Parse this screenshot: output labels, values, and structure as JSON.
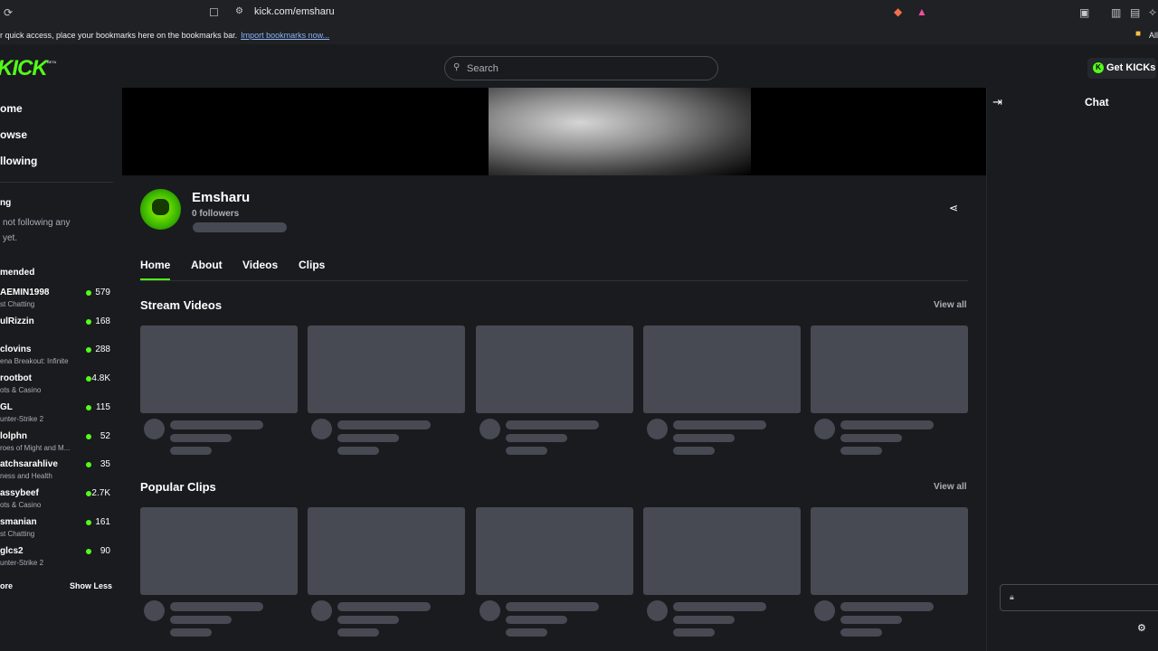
{
  "browser": {
    "url": "kick.com/emsharu",
    "bookmarks_text": "r quick access, place your bookmarks here on the bookmarks bar.",
    "bookmarks_link": "Import bookmarks now...",
    "bookmarks_right": "All",
    "reload_icon": "reload-icon",
    "bookmark_icon": "bookmark-icon"
  },
  "nav": {
    "logo": "KICK",
    "logo_badge": "BETA",
    "search_placeholder": "Search",
    "get_kicks": "Get KICKs"
  },
  "sidebar": {
    "nav": [
      "ome",
      "owse",
      "llowing"
    ],
    "following_heading": "ng",
    "following_empty_1": "not following any",
    "following_empty_2": "yet.",
    "recommended_heading": "mended",
    "recommended": [
      {
        "name": "AEMIN1998",
        "category": "st Chatting",
        "viewers": "579"
      },
      {
        "name": "ulRizzin",
        "category": "",
        "viewers": "168"
      },
      {
        "name": "clovins",
        "category": "ena Breakout: Infinite",
        "viewers": "288"
      },
      {
        "name": "rootbot",
        "category": "ots & Casino",
        "viewers": "4.8K"
      },
      {
        "name": "GL",
        "category": "unter-Strike 2",
        "viewers": "115"
      },
      {
        "name": "lolphn",
        "category": "roes of Might and M...",
        "viewers": "52"
      },
      {
        "name": "atchsarahlive",
        "category": "ness and Health",
        "viewers": "35"
      },
      {
        "name": "assybeef",
        "category": "ots & Casino",
        "viewers": "2.7K"
      },
      {
        "name": "smanian",
        "category": "st Chatting",
        "viewers": "161"
      },
      {
        "name": "glcs2",
        "category": "unter-Strike 2",
        "viewers": "90"
      }
    ],
    "show_more": "ore",
    "show_less": "Show Less"
  },
  "channel": {
    "name": "Emsharu",
    "followers": "0 followers",
    "tabs": [
      "Home",
      "About",
      "Videos",
      "Clips"
    ],
    "active_tab": "Home"
  },
  "sections": [
    {
      "title": "Stream Videos",
      "view_all": "View all"
    },
    {
      "title": "Popular Clips",
      "view_all": "View all"
    }
  ],
  "chat": {
    "title": "Chat"
  },
  "colors": {
    "accent": "#53fc18",
    "background": "#191b1f",
    "skeleton": "#474a52"
  }
}
